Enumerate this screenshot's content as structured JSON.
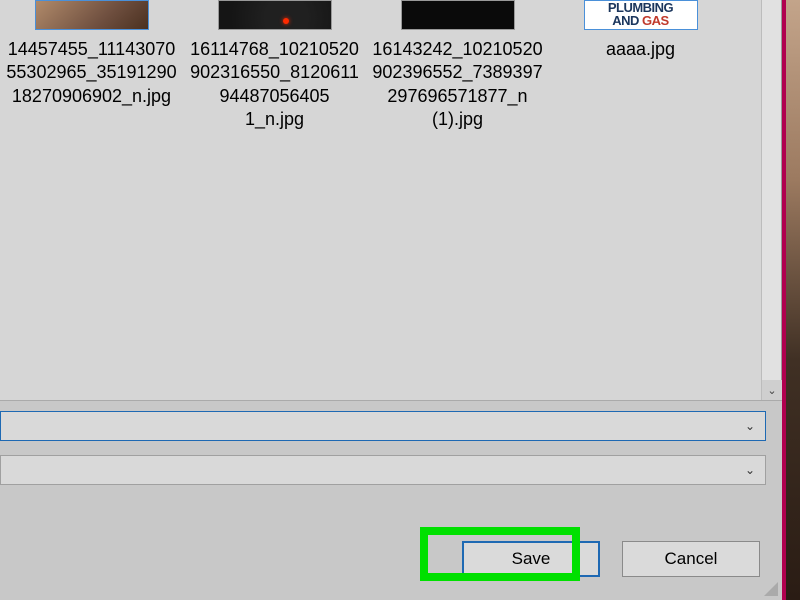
{
  "files": [
    {
      "thumb_class": "thumb1",
      "name": "14457455_1114307055302965_3519129018270906902_n.jpg"
    },
    {
      "thumb_class": "thumb2",
      "name": "16114768_10210520902316550_812061194487056405 1_n.jpg"
    },
    {
      "thumb_class": "thumb3",
      "name": "16143242_10210520902396552_7389397297696571877_n (1).jpg"
    },
    {
      "thumb_class": "thumb4",
      "name": "aaaa.jpg",
      "thumb_text": {
        "line1": "PLUMBING",
        "line2a": "AND ",
        "line2b": "GAS"
      }
    }
  ],
  "buttons": {
    "save_label": "Save",
    "cancel_label": "Cancel"
  },
  "icons": {
    "chevron_down": "⌄",
    "scroll_down": "⌄"
  }
}
